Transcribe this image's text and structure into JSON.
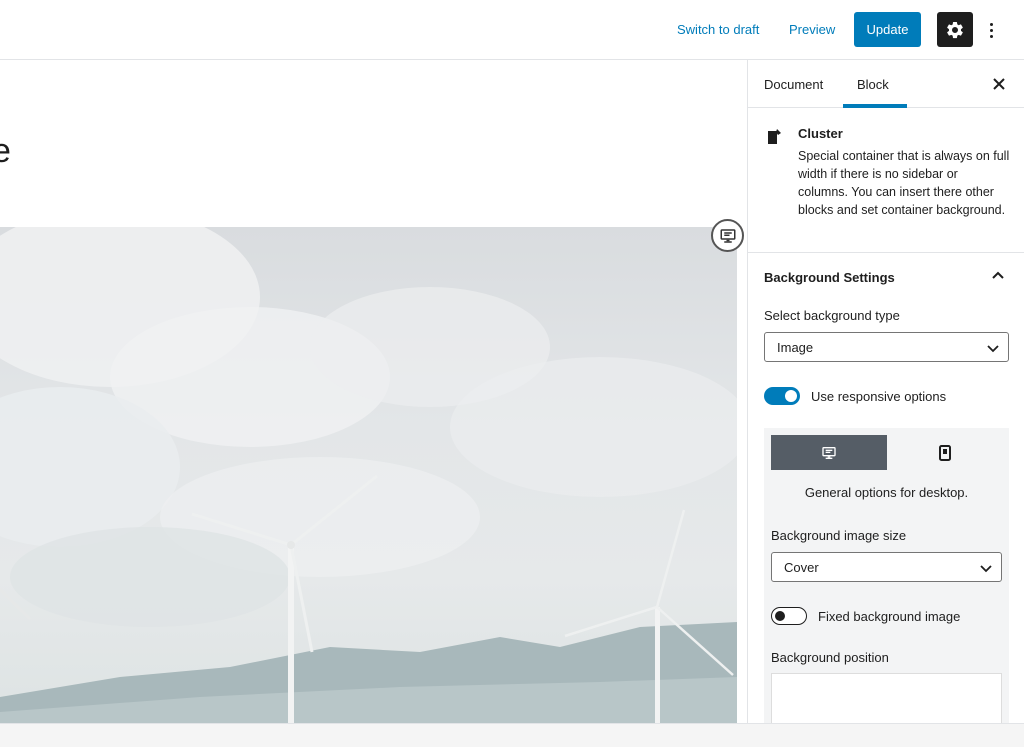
{
  "header": {
    "switch_to_draft": "Switch to draft",
    "preview": "Preview",
    "update": "Update"
  },
  "editor": {
    "title_fragment": "e"
  },
  "sidebar": {
    "tabs": [
      {
        "label": "Document"
      },
      {
        "label": "Block"
      }
    ],
    "active_tab": "Block",
    "block": {
      "name": "Cluster",
      "description": "Special container that is always on full width if there is no sidebar or columns. You can insert there other blocks and set container background."
    },
    "background_settings": {
      "title": "Background Settings",
      "type_label": "Select background type",
      "type_value": "Image",
      "responsive_label": "Use responsive options",
      "responsive_on": true,
      "device_caption": "General options for desktop.",
      "size_label": "Background image size",
      "size_value": "Cover",
      "fixed_label": "Fixed background image",
      "fixed_on": false,
      "position_label": "Background position"
    }
  },
  "colors": {
    "accent": "#007cba",
    "dark": "#1e1e1e",
    "device_active": "#555d66"
  }
}
